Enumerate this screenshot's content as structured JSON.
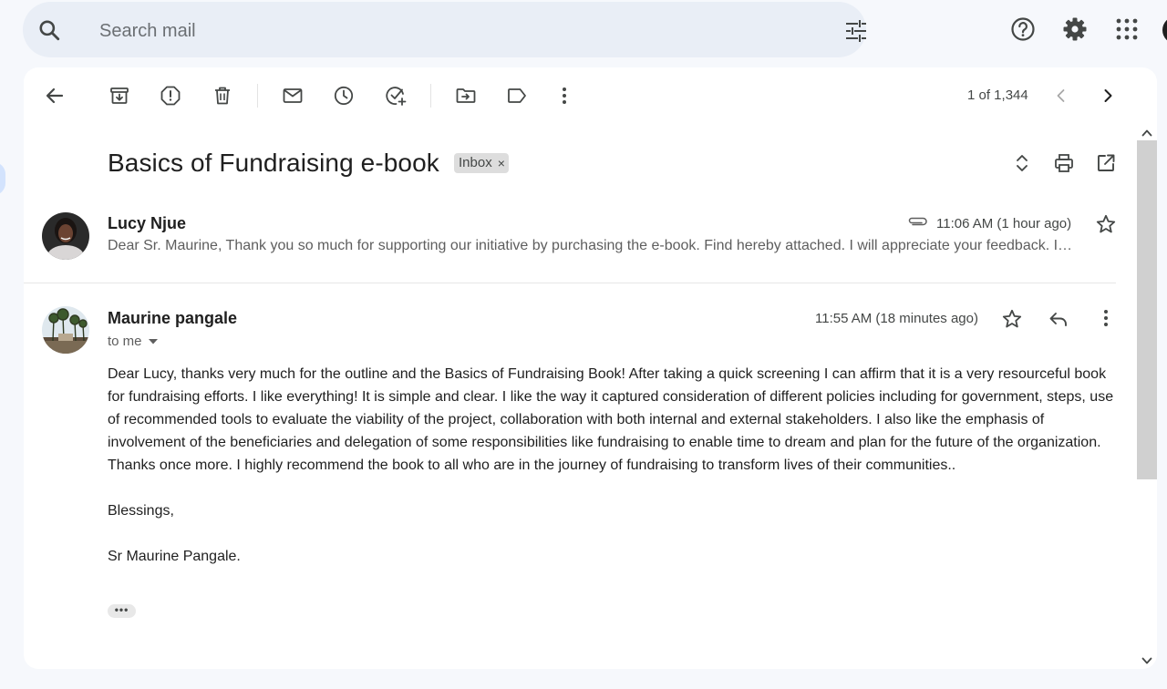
{
  "search": {
    "placeholder": "Search mail"
  },
  "toolbar": {
    "pager": "1 of 1,344"
  },
  "email": {
    "subject": "Basics of Fundraising e-book",
    "label_chip": "Inbox",
    "label_remove": "×"
  },
  "messages": [
    {
      "sender": "Lucy Njue",
      "time": "11:06 AM (1 hour ago)",
      "snippet": "Dear Sr. Maurine, Thank you so much for supporting our initiative by purchasing the e-book. Find hereby attached. I will appreciate your feedback. I…"
    },
    {
      "sender": "Maurine pangale",
      "time": "11:55 AM (18 minutes ago)",
      "recipient": "to me",
      "body": [
        "Dear Lucy, thanks very much for the outline and the Basics of Fundraising Book!  After taking a quick screening I can affirm that it is a very resourceful book for fundraising efforts. I like everything! It is simple and clear. I like the way it captured consideration of  different policies including for government,  steps, use of recommended tools to evaluate the viability of the project, collaboration with both internal and external stakeholders. I also like the emphasis of involvement of the beneficiaries and delegation of some responsibilities like fundraising to enable time to dream and plan for the future of the organization.",
        "Thanks once more. I highly recommend the book to all who are in the journey of fundraising to transform lives of their communities..",
        "Blessings,",
        "Sr Maurine Pangale."
      ],
      "more_label": "•••"
    }
  ],
  "colors": {
    "page_bg": "#f6f8fc",
    "search_bg": "#e9eef6",
    "card_bg": "#ffffff",
    "chip_bg": "#dddddd"
  },
  "icons": {
    "search": "search-icon",
    "tune": "tune-icon",
    "help": "help-icon",
    "settings": "gear-icon",
    "apps": "apps-grid-icon"
  }
}
